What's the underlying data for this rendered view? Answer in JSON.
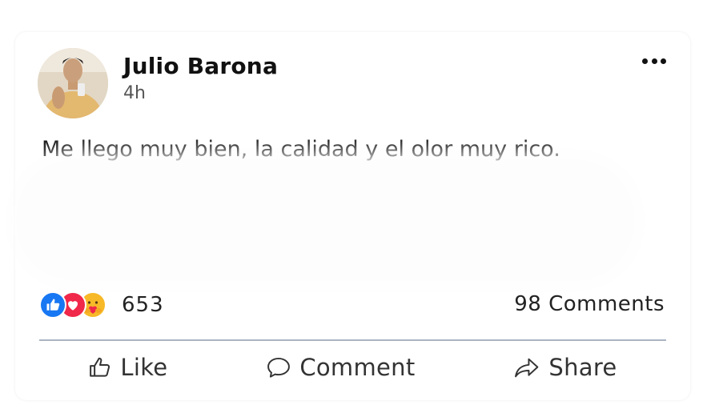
{
  "post": {
    "author": "Julio Barona",
    "time": "4h",
    "text": "Me llego muy bien, la calidad y el olor muy rico."
  },
  "reactions": {
    "icons": [
      "like-icon",
      "love-icon",
      "care-icon"
    ],
    "count": "653"
  },
  "comments_count": "98 Comments",
  "actions": {
    "like": "Like",
    "comment": "Comment",
    "share": "Share"
  },
  "colors": {
    "like_blue": "#1877f2",
    "love_red": "#f02849",
    "care_yellow": "#f7b928",
    "divider": "#aab4c3"
  }
}
